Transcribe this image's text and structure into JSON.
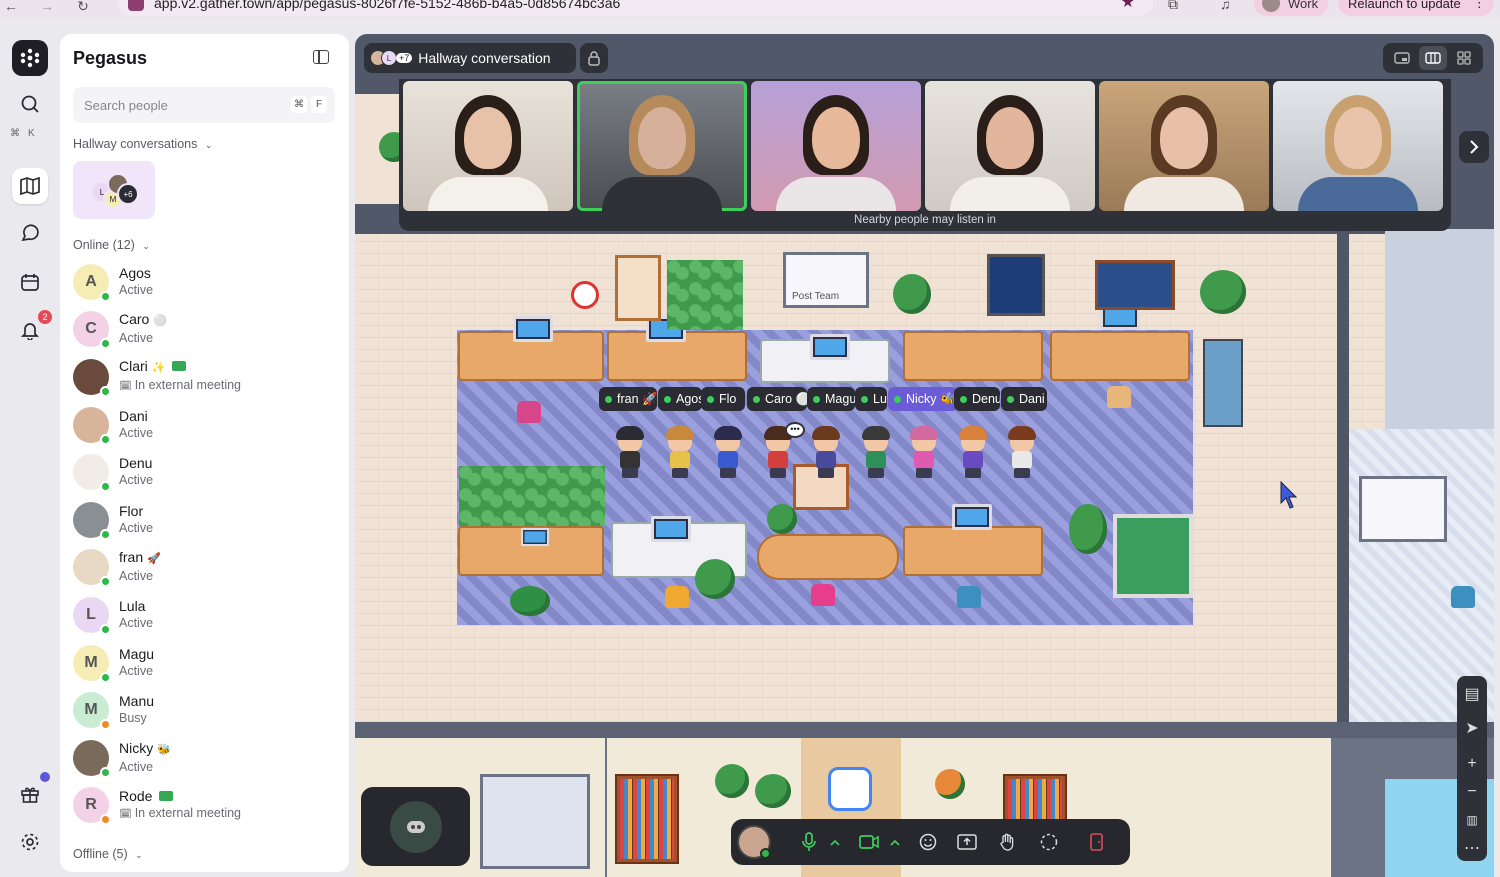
{
  "browser": {
    "url": "app.v2.gather.town/app/pegasus-8026f7fe-5152-486b-b4a5-0d85674bc3a6",
    "profile_label": "Work",
    "relaunch_label": "Relaunch to update"
  },
  "rail": {
    "search_shortcut": [
      "⌘",
      "K"
    ],
    "notifications_count": "2"
  },
  "sidebar": {
    "title": "Pegasus",
    "search_placeholder": "Search people",
    "search_shortcut": [
      "⌘",
      "F"
    ],
    "hallway_label": "Hallway conversations",
    "hallway_card": {
      "avatars": [
        "L",
        "M"
      ],
      "extra": "+6"
    },
    "online_label": "Online (12)",
    "offline_label": "Offline (5)",
    "people": [
      {
        "name": "Agos",
        "status": "Active",
        "initial": "A",
        "bg": "#f6edb4",
        "dot": "#2fb74a",
        "emoji": ""
      },
      {
        "name": "Caro",
        "status": "Active",
        "initial": "C",
        "bg": "#f3d1e6",
        "dot": "#2fb74a",
        "emoji": "⚪"
      },
      {
        "name": "Clari",
        "status": "In external meeting",
        "initial": "",
        "bg": "#6a4a3c",
        "dot": "#2fb74a",
        "emoji": "✨"
      },
      {
        "name": "Dani",
        "status": "Active",
        "initial": "",
        "bg": "#d8b49a",
        "dot": "#2fb74a",
        "emoji": ""
      },
      {
        "name": "Denu",
        "status": "Active",
        "initial": "",
        "bg": "#f1ece6",
        "dot": "#2fb74a",
        "emoji": ""
      },
      {
        "name": "Flor",
        "status": "Active",
        "initial": "",
        "bg": "#8a8f94",
        "dot": "#2fb74a",
        "emoji": ""
      },
      {
        "name": "fran",
        "status": "Active",
        "initial": "",
        "bg": "#e8d9c4",
        "dot": "#2fb74a",
        "emoji": "🚀"
      },
      {
        "name": "Lula",
        "status": "Active",
        "initial": "L",
        "bg": "#ead7f3",
        "dot": "#2fb74a",
        "emoji": ""
      },
      {
        "name": "Magu",
        "status": "Active",
        "initial": "M",
        "bg": "#f6edb4",
        "dot": "#2fb74a",
        "emoji": ""
      },
      {
        "name": "Manu",
        "status": "Busy",
        "initial": "M",
        "bg": "#c9ecd3",
        "dot": "#f08a24",
        "emoji": ""
      },
      {
        "name": "Nicky",
        "status": "Active",
        "initial": "",
        "bg": "#7a6a5c",
        "dot": "#2fb74a",
        "emoji": "🐝"
      },
      {
        "name": "Rode",
        "status": "In external meeting",
        "initial": "R",
        "bg": "#f3d1e6",
        "dot": "#f08a24",
        "emoji": ""
      }
    ]
  },
  "video": {
    "title": "Hallway conversation",
    "mini_avatars": [
      "L"
    ],
    "extra_count": "+7",
    "nearby_text": "Nearby people may listen in"
  },
  "map": {
    "name_chips": [
      "fran 🚀",
      "Agos",
      "Flo",
      "Caro ⚪",
      "Magu",
      "Lula",
      "Nicky 🐝",
      "Denu",
      "Dani"
    ],
    "whiteboard_label": "Post Team"
  }
}
